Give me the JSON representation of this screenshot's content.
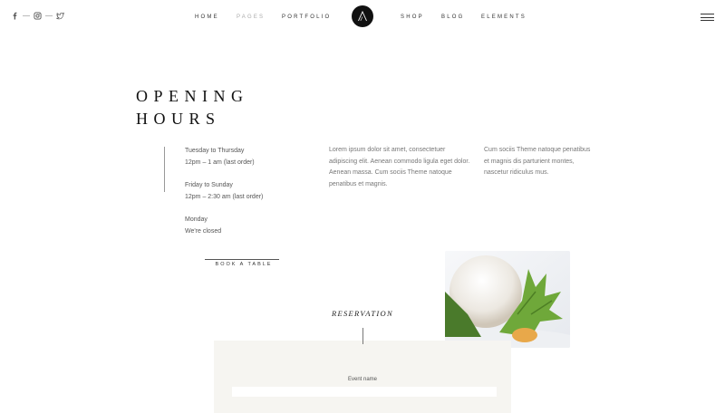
{
  "header": {
    "social": [
      {
        "name": "facebook"
      },
      {
        "name": "instagram"
      },
      {
        "name": "twitter"
      }
    ],
    "nav": {
      "home": "Home",
      "pages": "Pages",
      "portfolio": "Portfolio",
      "shop": "Shop",
      "blog": "Blog",
      "elements": "Elements"
    },
    "logo": "A",
    "active_nav": "pages"
  },
  "title": {
    "line1": "OPENING",
    "line2": "HOURS"
  },
  "hours": {
    "weekdays": "Tuesday to Thursday",
    "weekdays_time": "12pm – 1 am (last order)",
    "weekend": "Friday to Sunday",
    "weekend_time": "12pm – 2:30 am (last order)",
    "monday": "Monday",
    "monday_status": "We're closed"
  },
  "col1": {
    "line1": "Lorem ipsum dolor sit amet, consectetuer",
    "line2": "adipiscing elit. Aenean commodo ligula eget dolor.",
    "line3": "Aenean massa. Cum sociis Theme natoque",
    "line4": "penatibus et magnis."
  },
  "col2": {
    "line1": "Cum sociis Theme natoque penatibus",
    "line2": "et magnis dis parturient montes,",
    "line3": "nascetur ridiculus mus."
  },
  "book_button": "BOOK A TABLE",
  "reservation": {
    "title": "RESERVATION",
    "event_label": "Event name"
  }
}
